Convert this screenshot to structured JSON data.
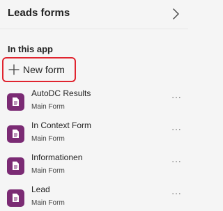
{
  "header": {
    "title": "Leads forms",
    "collapse_icon": "chevron-right-icon"
  },
  "section": {
    "label": "In this app"
  },
  "new_form": {
    "label": "New form",
    "icon": "plus-icon",
    "highlight_color": "#e0242f"
  },
  "forms": [
    {
      "title": "AutoDC Results",
      "subtitle": "Main Form",
      "icon": "form-document-icon",
      "more": "···"
    },
    {
      "title": "In Context Form",
      "subtitle": "Main Form",
      "icon": "form-document-icon",
      "more": "···"
    },
    {
      "title": "Informationen",
      "subtitle": "Main Form",
      "icon": "form-document-icon",
      "more": "···"
    },
    {
      "title": "Lead",
      "subtitle": "Main Form",
      "icon": "form-document-icon",
      "more": "···"
    }
  ],
  "colors": {
    "form_icon_bg": "#7b2b74",
    "panel_bg": "#f5f5f5"
  }
}
